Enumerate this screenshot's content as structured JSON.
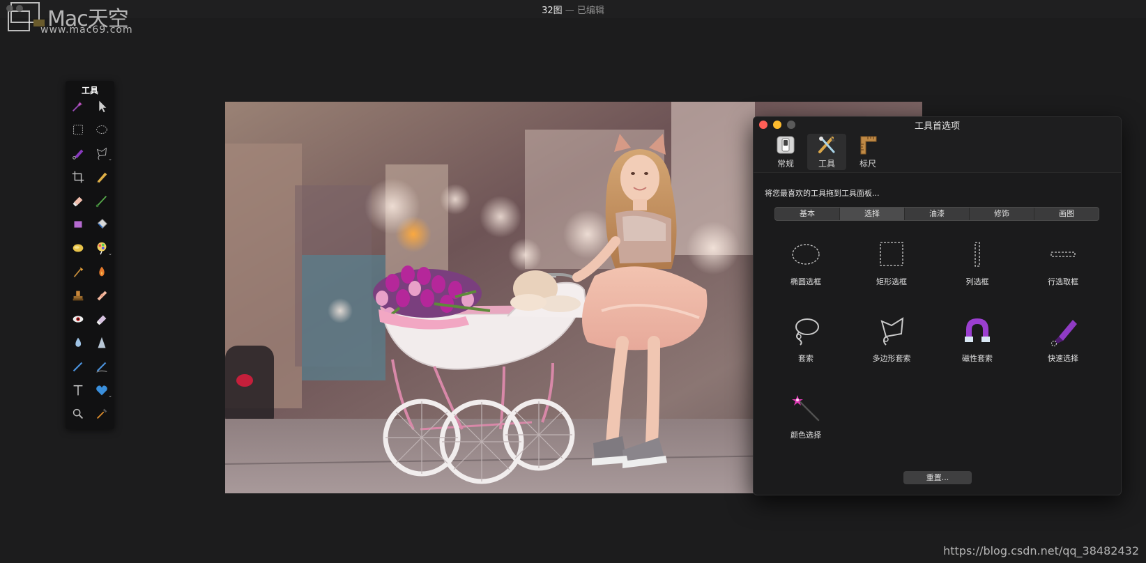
{
  "window": {
    "title": "32图",
    "title_suffix": "— 已编辑"
  },
  "watermark": {
    "brand": "Mac天空",
    "url": "www.mac69.com"
  },
  "tools_palette": {
    "title": "工具",
    "tools": [
      {
        "icon": "magic-wand-icon"
      },
      {
        "icon": "move-arrow-icon"
      },
      {
        "icon": "rect-marquee-icon"
      },
      {
        "icon": "ellipse-marquee-icon"
      },
      {
        "icon": "quick-selection-icon"
      },
      {
        "icon": "lasso-icon"
      },
      {
        "icon": "crop-icon"
      },
      {
        "icon": "pencil-icon"
      },
      {
        "icon": "eraser-icon"
      },
      {
        "icon": "brush-icon"
      },
      {
        "icon": "shape-rectangle-icon"
      },
      {
        "icon": "paint-bucket-icon"
      },
      {
        "icon": "gradient-icon"
      },
      {
        "icon": "color-picker-icon"
      },
      {
        "icon": "smudge-icon"
      },
      {
        "icon": "burn-icon"
      },
      {
        "icon": "clone-stamp-icon"
      },
      {
        "icon": "bandage-icon"
      },
      {
        "icon": "red-eye-icon"
      },
      {
        "icon": "eraser2-icon"
      },
      {
        "icon": "blur-drop-icon"
      },
      {
        "icon": "sharpen-icon"
      },
      {
        "icon": "pen-icon"
      },
      {
        "icon": "pen-freeform-icon"
      },
      {
        "icon": "text-icon"
      },
      {
        "icon": "heart-shape-icon"
      },
      {
        "icon": "zoom-icon"
      },
      {
        "icon": "eyedropper-icon"
      }
    ]
  },
  "prefs": {
    "title": "工具首选项",
    "tabs": [
      {
        "label": "常规",
        "icon": "switch-icon"
      },
      {
        "label": "工具",
        "icon": "tools-icon"
      },
      {
        "label": "标尺",
        "icon": "ruler-icon"
      }
    ],
    "active_tab": "工具",
    "prompt": "将您最喜欢的工具拖到工具面板...",
    "segments": [
      "基本",
      "选择",
      "油漆",
      "修饰",
      "画图"
    ],
    "selected_segment": "选择",
    "tools": [
      {
        "label": "椭圆选框",
        "icon": "ellipse-marquee-icon"
      },
      {
        "label": "矩形选框",
        "icon": "rect-marquee-icon"
      },
      {
        "label": "列选框",
        "icon": "column-marquee-icon"
      },
      {
        "label": "行选取框",
        "icon": "row-marquee-icon"
      },
      {
        "label": "套索",
        "icon": "lasso-icon"
      },
      {
        "label": "多边形套索",
        "icon": "polygon-lasso-icon"
      },
      {
        "label": "磁性套索",
        "icon": "magnetic-lasso-icon"
      },
      {
        "label": "快速选择",
        "icon": "quick-selection-icon"
      },
      {
        "label": "颜色选择",
        "icon": "color-selection-wand-icon"
      }
    ],
    "reset_label": "重置..."
  },
  "footer": {
    "url": "https://blog.csdn.net/qq_38482432"
  },
  "colors": {
    "close": "#ff5f57",
    "minimize": "#febc2e",
    "zoom_disabled": "#5a5a5a",
    "accent_purple": "#9b3fd0"
  }
}
